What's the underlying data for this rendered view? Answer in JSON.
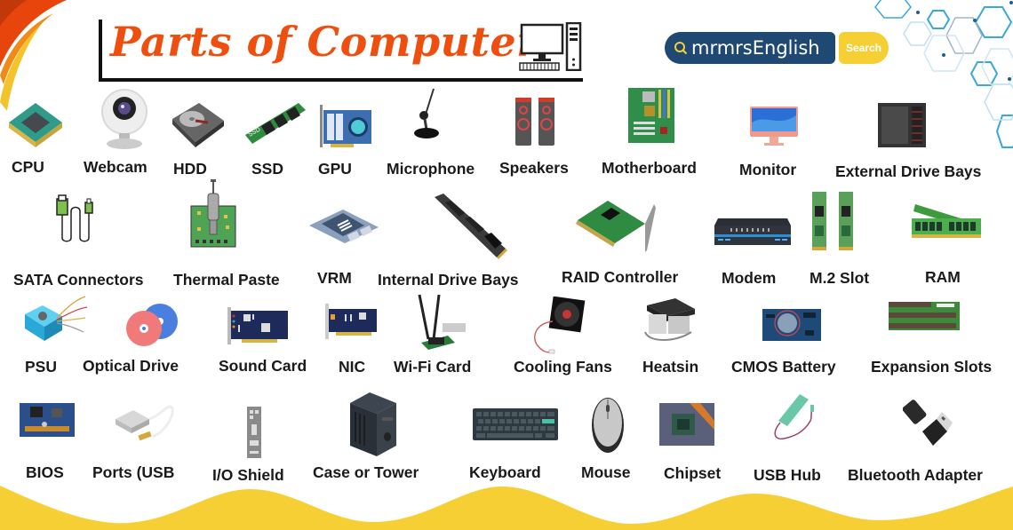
{
  "header": {
    "title": "Parts of Computer",
    "brand": "mrmrsEnglish",
    "search_label": "Search"
  },
  "colors": {
    "title": "#ef4f0e",
    "brand_bg": "#1f4873",
    "search_bg": "#f6cf35",
    "wave": "#f6cf35"
  },
  "rows": [
    {
      "items": [
        {
          "label": "CPU",
          "icon": "cpu-icon"
        },
        {
          "label": "Webcam",
          "icon": "webcam-icon"
        },
        {
          "label": "HDD",
          "icon": "hdd-icon"
        },
        {
          "label": "SSD",
          "icon": "ssd-icon"
        },
        {
          "label": "GPU",
          "icon": "gpu-icon"
        },
        {
          "label": "Microphone",
          "icon": "microphone-icon"
        },
        {
          "label": "Speakers",
          "icon": "speakers-icon"
        },
        {
          "label": "Motherboard",
          "icon": "motherboard-icon"
        },
        {
          "label": "Monitor",
          "icon": "monitor-icon"
        },
        {
          "label": "External Drive Bays",
          "icon": "external-drive-bays-icon"
        }
      ]
    },
    {
      "items": [
        {
          "label": "SATA Connectors",
          "icon": "sata-connectors-icon"
        },
        {
          "label": "Thermal Paste",
          "icon": "thermal-paste-icon"
        },
        {
          "label": "VRM",
          "icon": "vrm-icon"
        },
        {
          "label": "Internal Drive Bays",
          "icon": "internal-drive-bays-icon"
        },
        {
          "label": "RAID Controller",
          "icon": "raid-controller-icon"
        },
        {
          "label": "Modem",
          "icon": "modem-icon"
        },
        {
          "label": "M.2 Slot",
          "icon": "m2-slot-icon"
        },
        {
          "label": "RAM",
          "icon": "ram-icon"
        }
      ]
    },
    {
      "items": [
        {
          "label": "PSU",
          "icon": "psu-icon"
        },
        {
          "label": "Optical Drive",
          "icon": "optical-drive-icon"
        },
        {
          "label": "Sound Card",
          "icon": "sound-card-icon"
        },
        {
          "label": "NIC",
          "icon": "nic-icon"
        },
        {
          "label": "Wi-Fi Card",
          "icon": "wifi-card-icon"
        },
        {
          "label": "Cooling Fans",
          "icon": "cooling-fans-icon"
        },
        {
          "label": "Heatsin",
          "icon": "heatsink-icon"
        },
        {
          "label": "CMOS Battery",
          "icon": "cmos-battery-icon"
        },
        {
          "label": "Expansion Slots",
          "icon": "expansion-slots-icon"
        }
      ]
    },
    {
      "items": [
        {
          "label": "BIOS",
          "icon": "bios-icon"
        },
        {
          "label": "Ports (USB",
          "icon": "usb-ports-icon"
        },
        {
          "label": "I/O Shield",
          "icon": "io-shield-icon"
        },
        {
          "label": "Case or Tower",
          "icon": "case-tower-icon"
        },
        {
          "label": "Keyboard",
          "icon": "keyboard-icon"
        },
        {
          "label": "Mouse",
          "icon": "mouse-icon"
        },
        {
          "label": "Chipset",
          "icon": "chipset-icon"
        },
        {
          "label": "USB Hub",
          "icon": "usb-hub-icon"
        },
        {
          "label": "Bluetooth Adapter",
          "icon": "bluetooth-adapter-icon"
        }
      ]
    }
  ]
}
